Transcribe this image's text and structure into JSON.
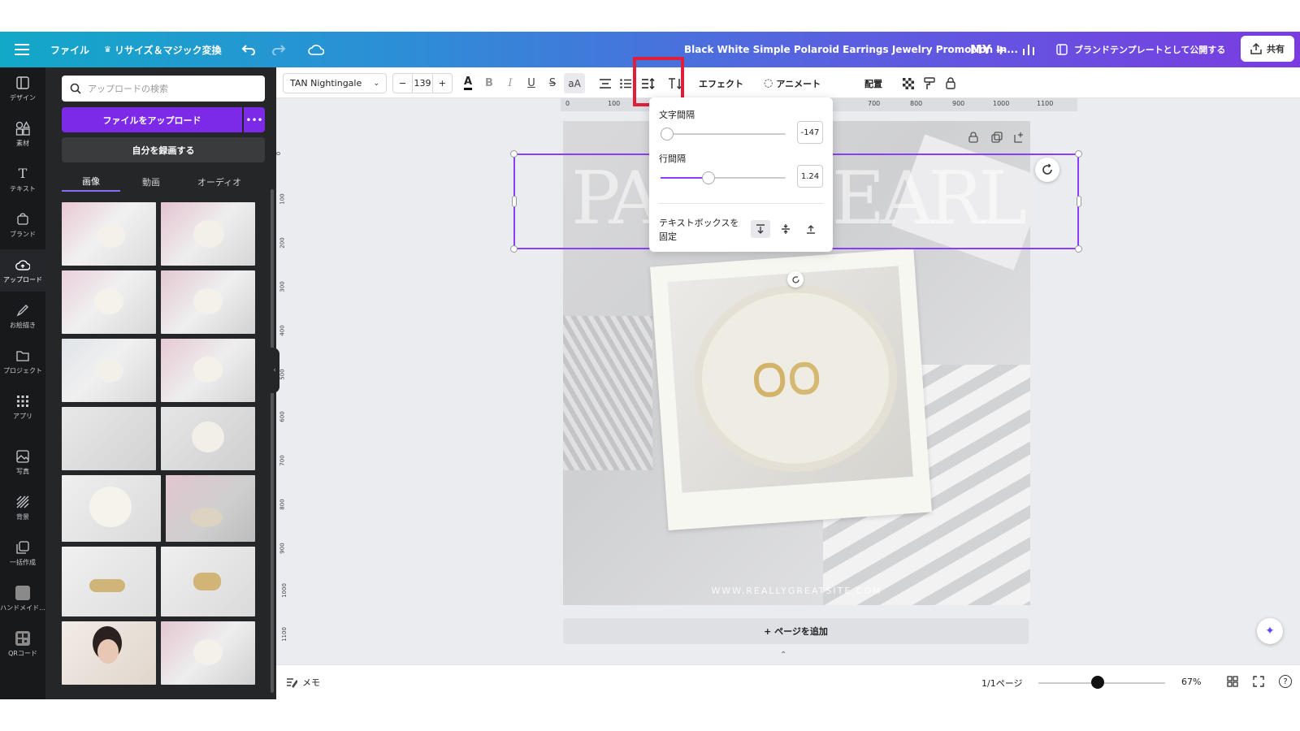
{
  "topbar": {
    "file": "ファイル",
    "resize": "リサイズ＆マジック変換",
    "doc_title": "Black White Simple Polaroid Earrings Jewelry Promotion In...",
    "avatar": "MY",
    "publish": "ブランドテンプレートとして公開する",
    "share": "共有"
  },
  "leftnav": {
    "items": [
      "デザイン",
      "素材",
      "テキスト",
      "ブランド",
      "アップロード",
      "お絵描き",
      "プロジェクト",
      "アプリ",
      "写真",
      "背景",
      "一括作成",
      "ハンドメイド...",
      "QRコード"
    ]
  },
  "panel": {
    "search_placeholder": "アップロードの検索",
    "upload_button": "ファイルをアップロード",
    "record_button": "自分を録画する",
    "tabs": [
      "画像",
      "動画",
      "オーディオ"
    ]
  },
  "toolbar": {
    "font": "TAN Nightingale",
    "font_size": "139",
    "minus": "−",
    "plus": "+",
    "effects": "エフェクト",
    "animate": "アニメート",
    "position": "配置"
  },
  "ruler": {
    "h": [
      "0",
      "100",
      "700",
      "800",
      "900",
      "1000",
      "1100"
    ],
    "v": [
      "0",
      "100",
      "200",
      "300",
      "400",
      "500",
      "600",
      "700",
      "800",
      "900",
      "1000",
      "1100"
    ]
  },
  "spacing_popup": {
    "letter_label": "文字間隔",
    "letter_value": "-147",
    "letter_fraction": 0.05,
    "line_label": "行間隔",
    "line_value": "1.24",
    "line_fraction": 0.38,
    "anchor_label_1": "テキストボックスを",
    "anchor_label_2": "固定"
  },
  "canvas": {
    "headline_left": "PA",
    "headline_right": "EARL",
    "website": "WWW.REALLYGREATSITE.COM",
    "add_page": "+ ページを追加"
  },
  "bottom": {
    "notes": "メモ",
    "page_count": "1/1ページ",
    "zoom": "67%",
    "zoom_fraction": 0.47
  },
  "colors": {
    "accent": "#7d2ae8",
    "selection": "#8b3dff",
    "highlight": "#e01e3a"
  }
}
